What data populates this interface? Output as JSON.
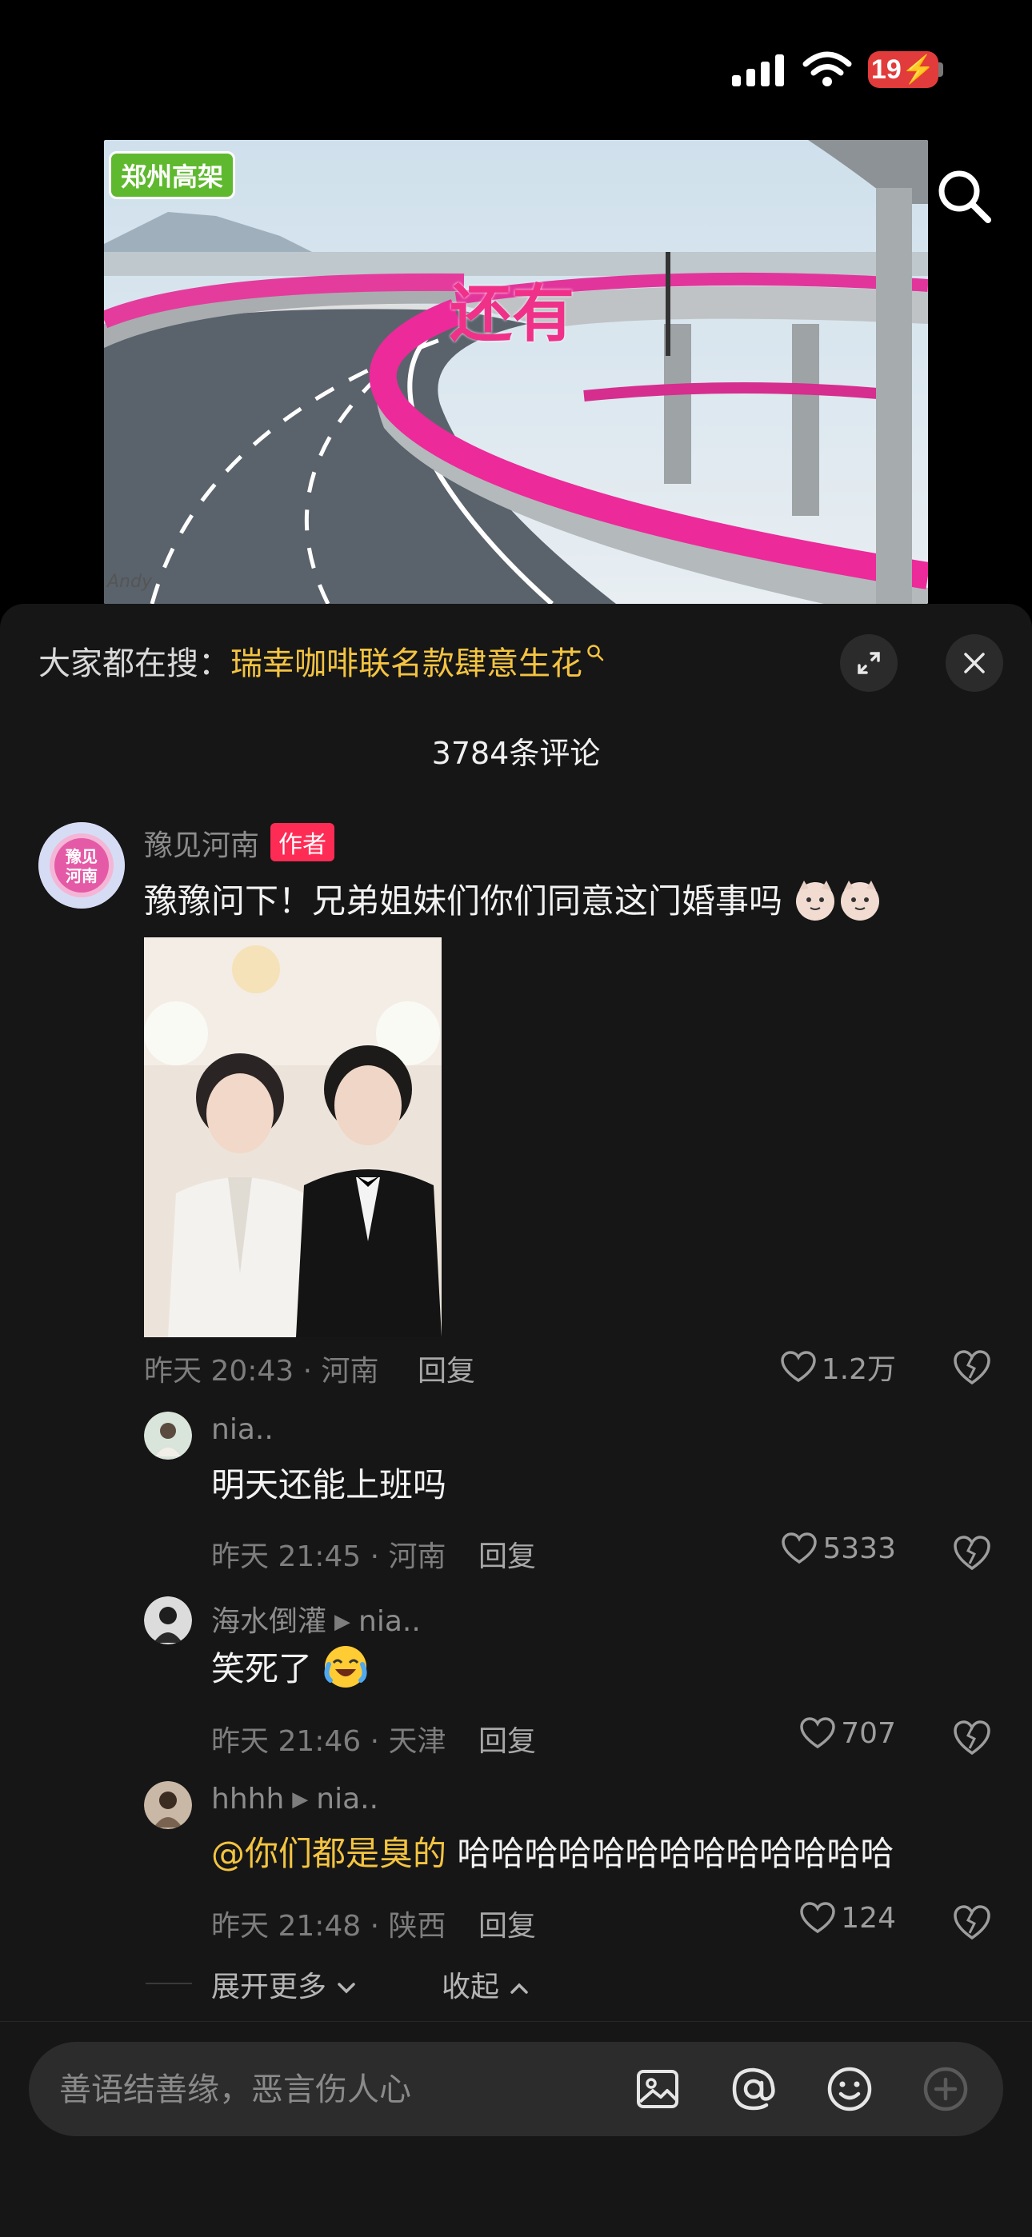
{
  "status_bar": {
    "battery": "19"
  },
  "video": {
    "watermark_logo": "郑州高架",
    "overlay_text": "还有",
    "corner_mark": "Andy"
  },
  "sheet": {
    "hot_search_prefix": "大家都在搜：",
    "hot_search_keyword": "瑞幸咖啡联名款肆意生花",
    "comment_count": "3784条评论"
  },
  "comments": [
    {
      "user": "豫见河南",
      "avatar_text": "豫见河南",
      "tag": "作者",
      "text": "豫豫问下！兄弟姐妹们你们同意这门婚事吗",
      "meta": "昨天 20:43 · 河南",
      "reply_label": "回复",
      "likes": "1.2万"
    },
    {
      "user": "nia..",
      "text": "明天还能上班吗",
      "meta": "昨天 21:45 · 河南",
      "reply_label": "回复",
      "likes": "5333"
    },
    {
      "user": "海水倒灌",
      "reply_to": "nia..",
      "text": "笑死了",
      "meta": "昨天 21:46 · 天津",
      "reply_label": "回复",
      "likes": "707"
    },
    {
      "user": "hhhh",
      "reply_to": "nia..",
      "mention": "@你们都是臭的",
      "text": "哈哈哈哈哈哈哈哈哈哈哈哈哈",
      "meta": "昨天 21:48 · 陕西",
      "reply_label": "回复",
      "likes": "124"
    }
  ],
  "thread_controls": {
    "expand_more": "展开更多",
    "collapse": "收起"
  },
  "input": {
    "placeholder": "善语结善缘，恶言伤人心"
  },
  "colors": {
    "accent_yellow": "#f4c441",
    "author_tag": "#fe2c55",
    "sheet_bg": "#161616"
  }
}
